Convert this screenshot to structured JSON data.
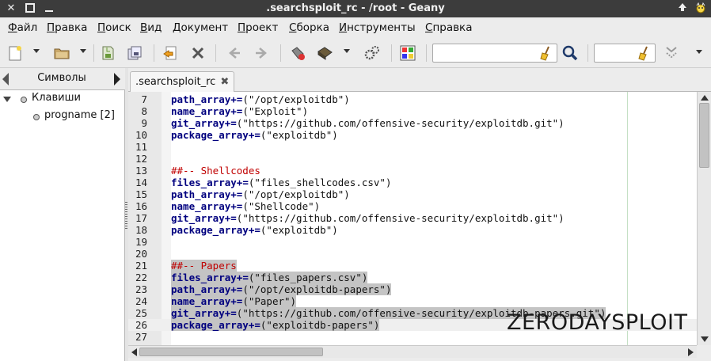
{
  "window": {
    "title": ".searchsploit_rc - /root - Geany"
  },
  "menu": {
    "items": [
      {
        "first": "Ф",
        "rest": "айл"
      },
      {
        "first": "П",
        "rest": "равка"
      },
      {
        "first": "П",
        "rest": "оиск"
      },
      {
        "first": "В",
        "rest": "ид"
      },
      {
        "first": "Д",
        "rest": "окумент"
      },
      {
        "first": "П",
        "rest": "роект"
      },
      {
        "first": "С",
        "rest": "борка"
      },
      {
        "first": "И",
        "rest": "нструменты"
      },
      {
        "first": "С",
        "rest": "правка"
      }
    ]
  },
  "toolbar": {
    "search_value": "",
    "goto_value": ""
  },
  "sidebar": {
    "tab_label": "Символы",
    "tree": {
      "root": "Клавиши",
      "child": "progname [2]"
    }
  },
  "editor": {
    "tab_label": ".searchsploit_rc",
    "lines": [
      {
        "n": "7",
        "kw": "path_array",
        "op": "+=",
        "rest": "(\"/opt/exploitdb\")"
      },
      {
        "n": "8",
        "kw": "name_array",
        "op": "+=",
        "rest": "(\"Exploit\")"
      },
      {
        "n": "9",
        "kw": "git_array",
        "op": "+=",
        "rest": "(\"https://github.com/offensive-security/exploitdb.git\")"
      },
      {
        "n": "10",
        "kw": "package_array",
        "op": "+=",
        "rest": "(\"exploitdb\")"
      },
      {
        "n": "11",
        "kw": "",
        "op": "",
        "rest": ""
      },
      {
        "n": "12",
        "kw": "",
        "op": "",
        "rest": ""
      },
      {
        "n": "13",
        "comment": "##-- Shellcodes"
      },
      {
        "n": "14",
        "kw": "files_array",
        "op": "+=",
        "rest": "(\"files_shellcodes.csv\")"
      },
      {
        "n": "15",
        "kw": "path_array",
        "op": "+=",
        "rest": "(\"/opt/exploitdb\")"
      },
      {
        "n": "16",
        "kw": "name_array",
        "op": "+=",
        "rest": "(\"Shellcode\")"
      },
      {
        "n": "17",
        "kw": "git_array",
        "op": "+=",
        "rest": "(\"https://github.com/offensive-security/exploitdb.git\")"
      },
      {
        "n": "18",
        "kw": "package_array",
        "op": "+=",
        "rest": "(\"exploitdb\")"
      },
      {
        "n": "19",
        "kw": "",
        "op": "",
        "rest": ""
      },
      {
        "n": "20",
        "kw": "",
        "op": "",
        "rest": ""
      },
      {
        "n": "21",
        "comment": "##-- Papers",
        "selected": true
      },
      {
        "n": "22",
        "kw": "files_array",
        "op": "+=",
        "rest": "(\"files_papers.csv\")",
        "selected": true
      },
      {
        "n": "23",
        "kw": "path_array",
        "op": "+=",
        "rest": "(\"/opt/exploitdb-papers\")",
        "selected": true
      },
      {
        "n": "24",
        "kw": "name_array",
        "op": "+=",
        "rest": "(\"Paper\")",
        "selected": true
      },
      {
        "n": "25",
        "kw": "git_array",
        "op": "+=",
        "rest": "(\"https://github.com/offensive-security/exploitdb-papers.git\")",
        "selected": true
      },
      {
        "n": "26",
        "kw": "package_array",
        "op": "+=",
        "rest": "(\"exploitdb-papers\")",
        "selected": true,
        "current": true
      },
      {
        "n": "27",
        "kw": "",
        "op": "",
        "rest": ""
      }
    ]
  },
  "overlay": {
    "watermark": "ZERODAYSPLOIT"
  },
  "colors": {
    "keyword": "#00007f",
    "comment": "#c00000",
    "selection": "#c4c4c4",
    "titlebar": "#3c3c3c"
  }
}
